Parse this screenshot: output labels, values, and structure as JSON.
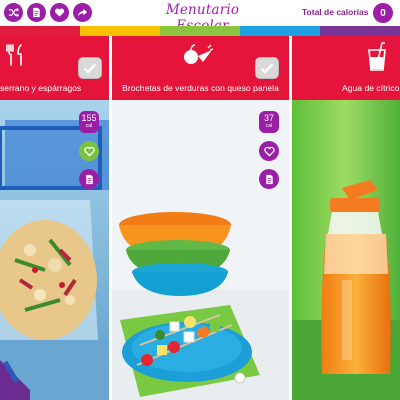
{
  "app": {
    "title": "Menutario Escolar",
    "total_label": "Total de calorías",
    "total_value": "0"
  },
  "toolbar": {
    "icons": [
      "shuffle-icon",
      "document-icon",
      "heart-icon",
      "share-icon"
    ]
  },
  "strip_colors": [
    "#e01d3f",
    "#f8c200",
    "#8bc53f",
    "#1da1e0",
    "#7a3596"
  ],
  "colors": {
    "accent": "#9b1fa6",
    "card_header": "#e5143b",
    "heart_button": "#7cc242"
  },
  "cards": [
    {
      "icon": "fork-knife-icon",
      "title": "Ensalada de pasta con jamón serrano y espárragos",
      "visible_title": "serrano y espárragos",
      "calories": "155",
      "unit": "cal"
    },
    {
      "icon": "vegetables-icon",
      "title": "Brochetas de verduras con queso panela",
      "calories": "37",
      "unit": "cal"
    },
    {
      "icon": "glass-straw-icon",
      "title": "Agua de cítricos",
      "visible_title": "Agua de cítrico"
    }
  ]
}
